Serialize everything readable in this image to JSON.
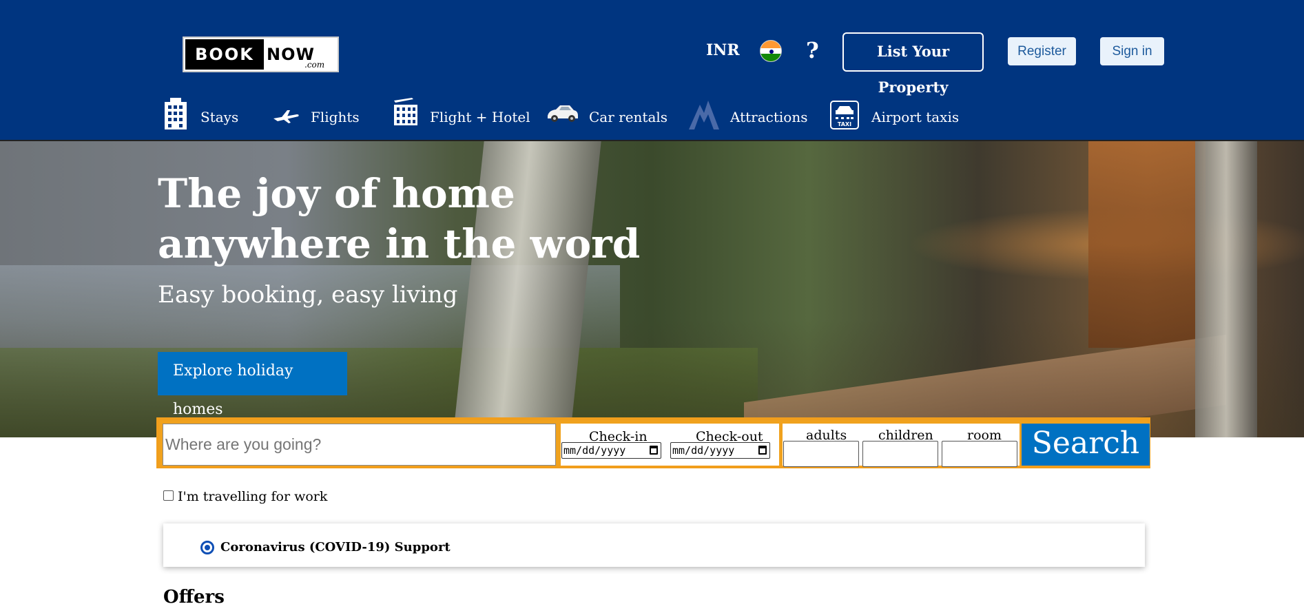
{
  "header": {
    "logo": {
      "book": "BOOK",
      "now": "NOW",
      "com": ".com"
    },
    "currency": "INR",
    "flag_icon": "india-flag-icon",
    "help": "?",
    "list_property": "List Your Property",
    "register": "Register",
    "signin": "Sign in",
    "colors": {
      "background": "#003580",
      "button_bg": "#e9f2fb",
      "button_text": "#1d5a9c"
    }
  },
  "nav": {
    "items": [
      {
        "label": "Stays",
        "icon": "building-icon"
      },
      {
        "label": "Flights",
        "icon": "airplane-icon"
      },
      {
        "label": "Flight + Hotel",
        "icon": "flight-hotel-icon"
      },
      {
        "label": "Car rentals",
        "icon": "car-icon"
      },
      {
        "label": "Attractions",
        "icon": "mountain-icon"
      },
      {
        "label": "Airport taxis",
        "icon": "taxi-icon"
      }
    ]
  },
  "hero": {
    "title": "The joy of home anywhere in the word",
    "subtitle": "Easy booking, easy living",
    "explore_button": "Explore holiday homes"
  },
  "search": {
    "destination_placeholder": "Where are you going?",
    "checkin_label": "Check-in",
    "checkout_label": "Check-out",
    "date_placeholder": "mm/dd/yyyy",
    "adults_label": "adults",
    "children_label": "children",
    "room_label": "room",
    "search_button": "Search",
    "colors": {
      "border": "#f0a21e",
      "button": "#0071c2"
    }
  },
  "work_checkbox": {
    "label": "I'm travelling for work",
    "checked": false
  },
  "covid": {
    "label": "Coronavirus (COVID-19) Support"
  },
  "offers": {
    "heading": "Offers"
  }
}
